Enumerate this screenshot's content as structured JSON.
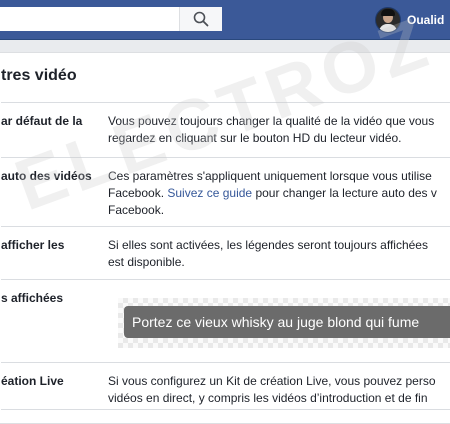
{
  "header": {
    "search_placeholder": "",
    "search_icon": "search-icon",
    "profile_name": "Oualid",
    "bar_color": "#3b5998"
  },
  "section": {
    "title_fragment": "tres vidéo"
  },
  "rows": [
    {
      "label": "ar défaut de la",
      "desc": [
        "Vous pouvez toujours changer la qualité de la vidéo que vous",
        "regardez en cliquant sur le bouton HD du lecteur vidéo."
      ]
    },
    {
      "label": "auto des vidéos",
      "desc_line1": "Ces paramètres s'appliquent uniquement lorsque vous utilise",
      "desc_line2_prefix": "Facebook. ",
      "desc_line2_link": "Suivez ce guide",
      "desc_line2_suffix": " pour changer la lecture auto des v",
      "desc_line3": "Facebook."
    },
    {
      "label": "afficher les",
      "desc": [
        "Si elles sont activées, les légendes seront toujours affichées",
        "est disponible."
      ]
    },
    {
      "label": "s affichées",
      "caption_preview": "Portez ce vieux whisky au juge blond qui fume"
    },
    {
      "label": "éation Live",
      "desc": [
        "Si vous configurez un Kit de création Live, vous pouvez perso",
        "vidéos en direct, y compris les vidéos d’introduction et de fin"
      ]
    }
  ],
  "watermark": "ELECTROZ",
  "colors": {
    "link": "#365899",
    "caption_bg": "#6b6b6b"
  }
}
